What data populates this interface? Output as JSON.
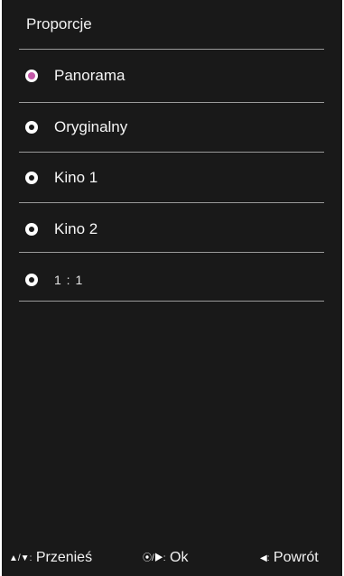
{
  "menu": {
    "title": "Proporcje",
    "options": [
      {
        "label": "Panorama",
        "selected": true
      },
      {
        "label": "Oryginalny",
        "selected": false
      },
      {
        "label": "Kino 1",
        "selected": false
      },
      {
        "label": "Kino 2",
        "selected": false
      },
      {
        "label": "1 : 1",
        "selected": false
      }
    ]
  },
  "footer": {
    "move_keys": "▲/▼:",
    "move_label": "Przenieś",
    "ok_keys": "⦿/▶:",
    "ok_label": "Ok",
    "back_keys": "◀:",
    "back_label": "Powrót"
  },
  "colors": {
    "panel_background": "#191919",
    "selected_radio": "#c458a8",
    "divider": "#9a9a9a"
  }
}
